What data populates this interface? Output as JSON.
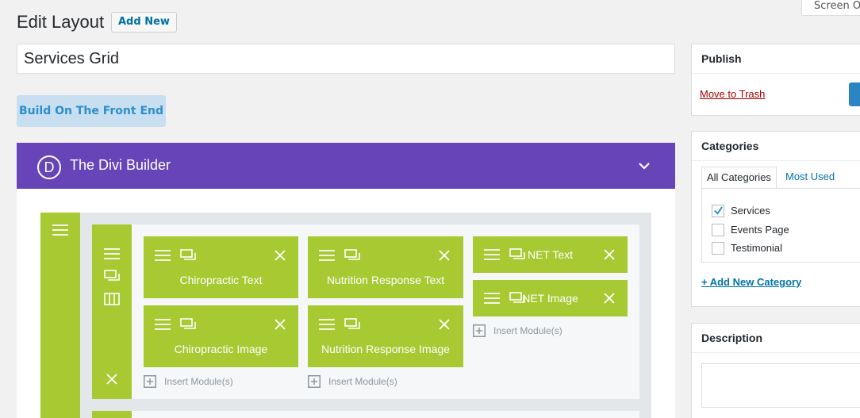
{
  "header": {
    "screen_options": "Screen Op",
    "page_title": "Edit Layout",
    "add_new": "Add New"
  },
  "title_field": {
    "value": "Services Grid"
  },
  "front_end_button": "Build On The Front End",
  "divi": {
    "logo_letter": "D",
    "title": "The Divi Builder",
    "columns": [
      {
        "modules": [
          {
            "label": "Chiropractic Text"
          },
          {
            "label": "Chiropractic Image"
          }
        ],
        "insert_label": "Insert Module(s)"
      },
      {
        "modules": [
          {
            "label": "Nutrition Response Text"
          },
          {
            "label": "Nutrition Response Image"
          }
        ],
        "insert_label": "Insert Module(s)"
      },
      {
        "modules": [
          {
            "label": "NET Text"
          },
          {
            "label": "NET Image"
          }
        ],
        "insert_label": "Insert Module(s)"
      }
    ]
  },
  "sidebar": {
    "publish": {
      "title": "Publish",
      "trash": "Move to Trash"
    },
    "categories": {
      "title": "Categories",
      "tabs": [
        "All Categories",
        "Most Used"
      ],
      "items": [
        {
          "label": "Services",
          "checked": true
        },
        {
          "label": "Events Page",
          "checked": false
        },
        {
          "label": "Testimonial",
          "checked": false
        }
      ],
      "add_new": "+ Add New Category"
    },
    "description": {
      "title": "Description"
    }
  },
  "colors": {
    "divi_purple": "#6745b8",
    "module_green": "#a7c932",
    "link_blue": "#0073aa",
    "trash_red": "#a00"
  }
}
